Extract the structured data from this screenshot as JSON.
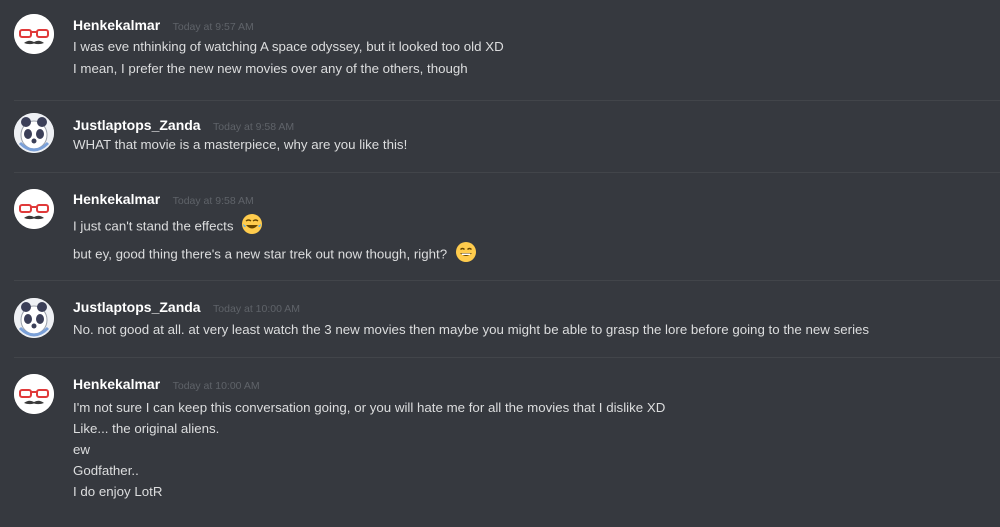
{
  "messages": [
    {
      "author": "Henkekalmar",
      "avatar": "mustache-glasses-avatar",
      "timestamp": "Today at 9:57 AM",
      "lines": [
        {
          "text": "I was eve nthinking of watching A space odyssey, but it looked too old XD"
        },
        {
          "text": "I mean, I prefer the new new movies over any of the others, though"
        }
      ]
    },
    {
      "author": "Justlaptops_Zanda",
      "avatar": "panda-avatar",
      "timestamp": "Today at 9:58 AM",
      "lines": [
        {
          "text": "WHAT that movie is a masterpiece, why are you like this!"
        }
      ]
    },
    {
      "author": "Henkekalmar",
      "avatar": "mustache-glasses-avatar",
      "timestamp": "Today at 9:58 AM",
      "lines": [
        {
          "text": "I just can't stand the effects",
          "emoji": "joy-emoji"
        },
        {
          "text": "but ey, good thing there's a new star trek out now though, right?",
          "emoji": "smile-emoji"
        }
      ]
    },
    {
      "author": "Justlaptops_Zanda",
      "avatar": "panda-avatar",
      "timestamp": "Today at 10:00 AM",
      "lines": [
        {
          "text": "No. not good at all. at very least watch the 3 new movies then maybe you might be able to grasp the lore before going to the new series"
        }
      ]
    },
    {
      "author": "Henkekalmar",
      "avatar": "mustache-glasses-avatar",
      "timestamp": "Today at 10:00 AM",
      "lines": [
        {
          "text": "I'm not sure I can keep this conversation going, or you will hate me for all the movies that I dislike XD"
        },
        {
          "text": "Like... the original aliens."
        },
        {
          "text": "ew"
        },
        {
          "text": "Godfather.."
        },
        {
          "text": "I do enjoy LotR"
        }
      ]
    }
  ],
  "colors": {
    "background": "#36393f",
    "username": "#ffffff",
    "timestamp": "#5f6369",
    "message_text": "#dcddde",
    "divider": "#42454a"
  }
}
